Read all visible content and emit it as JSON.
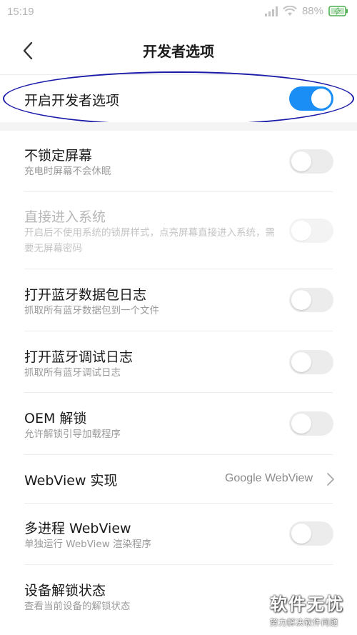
{
  "status_bar": {
    "time": "15:19",
    "battery_percent": "88%"
  },
  "header": {
    "title": "开发者选项"
  },
  "master_toggle": {
    "label": "开启开发者选项",
    "enabled": true
  },
  "settings": [
    {
      "title": "不锁定屏幕",
      "subtitle": "充电时屏幕不会休眠",
      "enabled": false,
      "disabled": false
    },
    {
      "title": "直接进入系统",
      "subtitle": "开启后不使用系统的锁屏样式，点亮屏幕直接进入系统，需要无屏幕密码",
      "enabled": false,
      "disabled": true
    },
    {
      "title": "打开蓝牙数据包日志",
      "subtitle": "抓取所有蓝牙数据包到一个文件",
      "enabled": false,
      "disabled": false
    },
    {
      "title": "打开蓝牙调试日志",
      "subtitle": "抓取所有蓝牙调试日志",
      "enabled": false,
      "disabled": false
    },
    {
      "title": "OEM 解锁",
      "subtitle": "允许解锁引导加载程序",
      "enabled": false,
      "disabled": false
    },
    {
      "title": "WebView 实现",
      "value": "Google WebView"
    },
    {
      "title": "多进程 WebView",
      "subtitle": "单独运行 WebView 渲染程序",
      "enabled": false,
      "disabled": false
    },
    {
      "title": "设备解锁状态",
      "subtitle": "查看当前设备的解锁状态"
    }
  ],
  "watermark": {
    "main": "软件无忧",
    "sub": "努力解决软件问题"
  },
  "colors": {
    "accent": "#1a8ef5",
    "highlight_ring": "#1a1aa8",
    "battery": "#4caf50"
  }
}
